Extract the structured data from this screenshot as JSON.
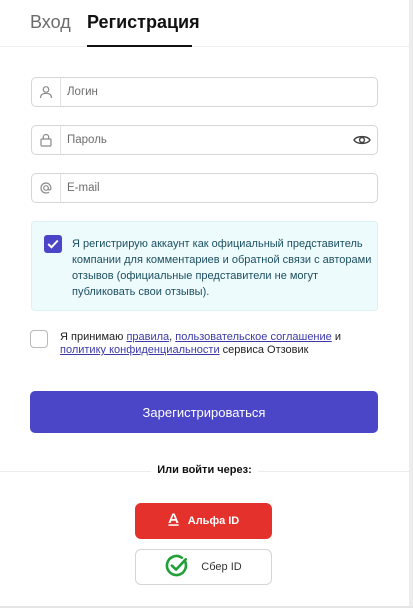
{
  "tabs": {
    "login": "Вход",
    "register": "Регистрация"
  },
  "fields": {
    "login_placeholder": "Логин",
    "password_placeholder": "Пароль",
    "email_placeholder": "E-mail"
  },
  "representative": {
    "checked": true,
    "text": "Я регистрирую аккаунт как официальный представитель компании для комментариев и обратной связи с авторами отзывов (официальные представители не могут публиковать свои отзывы)."
  },
  "terms": {
    "checked": false,
    "prefix": "Я принимаю ",
    "rules_link": "правила",
    "comma": ", ",
    "agreement_link": "пользовательское соглашение",
    "and": " и ",
    "privacy_link": "политику конфиденциальности",
    "suffix": " сервиса Отзовик"
  },
  "submit_label": "Зарегистрироваться",
  "social": {
    "heading": "Или войти через:",
    "alfa_label": "Альфа ID",
    "sber_label": "Сбер ID"
  },
  "colors": {
    "primary": "#4b45c8",
    "alfa_red": "#e5312b",
    "sber_green": "#21a038",
    "info_bg": "#eefbfd"
  },
  "icons": {
    "login": "user-icon",
    "password": "lock-icon",
    "email": "at-icon",
    "reveal": "eye-icon",
    "alfa": "alfa-logo-icon",
    "sber": "sber-logo-icon"
  }
}
